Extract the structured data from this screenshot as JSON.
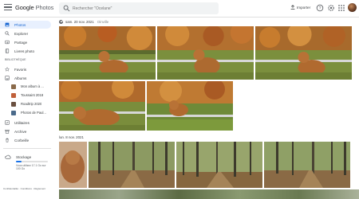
{
  "header": {
    "logo_google": "Google",
    "logo_product": "Photos",
    "search_placeholder": "Rechercher \"Ocelane\"",
    "import_label": "Importer"
  },
  "sidebar": {
    "items_top": [
      {
        "label": "Photos",
        "icon": "photo-icon",
        "active": true
      },
      {
        "label": "Explorer",
        "icon": "search-icon",
        "active": false
      },
      {
        "label": "Partage",
        "icon": "share-icon",
        "active": false
      },
      {
        "label": "Livres photo",
        "icon": "book-icon",
        "active": false
      }
    ],
    "section_library": "BIBLIOTHÈQUE",
    "items_library": [
      {
        "label": "Favoris",
        "icon": "star-icon"
      },
      {
        "label": "Albums",
        "icon": "album-icon"
      }
    ],
    "albums": [
      {
        "label": "Mon album à ...",
        "color": "#8a6a4a"
      },
      {
        "label": "Toussaint 2018",
        "color": "#c0603a"
      },
      {
        "label": "Roadtrip 2020",
        "color": "#6a5040"
      },
      {
        "label": "Photos de Paul...",
        "color": "#4a6a8a"
      }
    ],
    "items_bottom": [
      {
        "label": "Utilitaires",
        "icon": "check-icon"
      },
      {
        "label": "Archive",
        "icon": "archive-icon"
      },
      {
        "label": "Corbeille",
        "icon": "trash-icon"
      }
    ],
    "storage": {
      "title": "Stockage",
      "text": "Vous utilisez 17.1 Go sur 100 Go",
      "fraction": 0.171
    },
    "footer": "Confidentialité · Conditions · Règlement"
  },
  "main": {
    "sections": [
      {
        "date": "sam. 20 nov. 2021",
        "location": "Oinville"
      },
      {
        "date": "lun. 8 nov. 2021",
        "location": ""
      }
    ]
  },
  "colors": {
    "accent": "#1a73e8",
    "active_bg": "#e8f0fe"
  }
}
